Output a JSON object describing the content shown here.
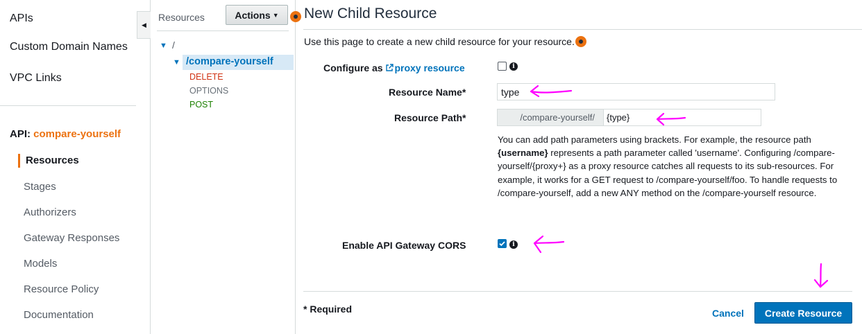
{
  "nav": {
    "top_items": [
      "APIs",
      "Custom Domain Names",
      "VPC Links"
    ],
    "api_prefix": "API:",
    "api_name": "compare-yourself",
    "active_item": "Resources",
    "sub_items": [
      "Stages",
      "Authorizers",
      "Gateway Responses",
      "Models",
      "Resource Policy",
      "Documentation"
    ]
  },
  "tree": {
    "header_label": "Resources",
    "actions_label": "Actions",
    "root": "/",
    "selected": "/compare-yourself",
    "methods": [
      "DELETE",
      "OPTIONS",
      "POST"
    ]
  },
  "form": {
    "title": "New Child Resource",
    "intro": "Use this page to create a new child resource for your resource.",
    "proxy_label_prefix": "Configure as ",
    "proxy_link": "proxy resource",
    "proxy_checked": false,
    "name_label": "Resource Name*",
    "name_value": "type",
    "path_label": "Resource Path*",
    "path_prefix": "/compare-yourself/",
    "path_value": "{type}",
    "help": {
      "p1": "You can add path parameters using brackets. For example, the resource path ",
      "bold": "{username}",
      "p2": " represents a path parameter called 'username'. Configuring /compare-yourself/{proxy+} as a proxy resource catches all requests to its sub-resources. For example, it works for a GET request to /compare-yourself/foo. To handle requests to /compare-yourself, add a new ANY method on the /compare-yourself resource."
    },
    "cors_label": "Enable API Gateway CORS",
    "cors_checked": true,
    "required_note": "* Required",
    "cancel_label": "Cancel",
    "create_label": "Create Resource"
  },
  "colors": {
    "accent": "#ec7211",
    "link": "#0073bb",
    "delete": "#d13212",
    "post": "#1d8102",
    "annotation": "#ff00ff"
  },
  "icons": {
    "collapse": "caret-left-icon",
    "tree_caret": "caret-down-icon",
    "help": "help-dot-icon",
    "info": "info-icon",
    "external": "external-link-icon",
    "annotation": "arrow-annotation"
  }
}
